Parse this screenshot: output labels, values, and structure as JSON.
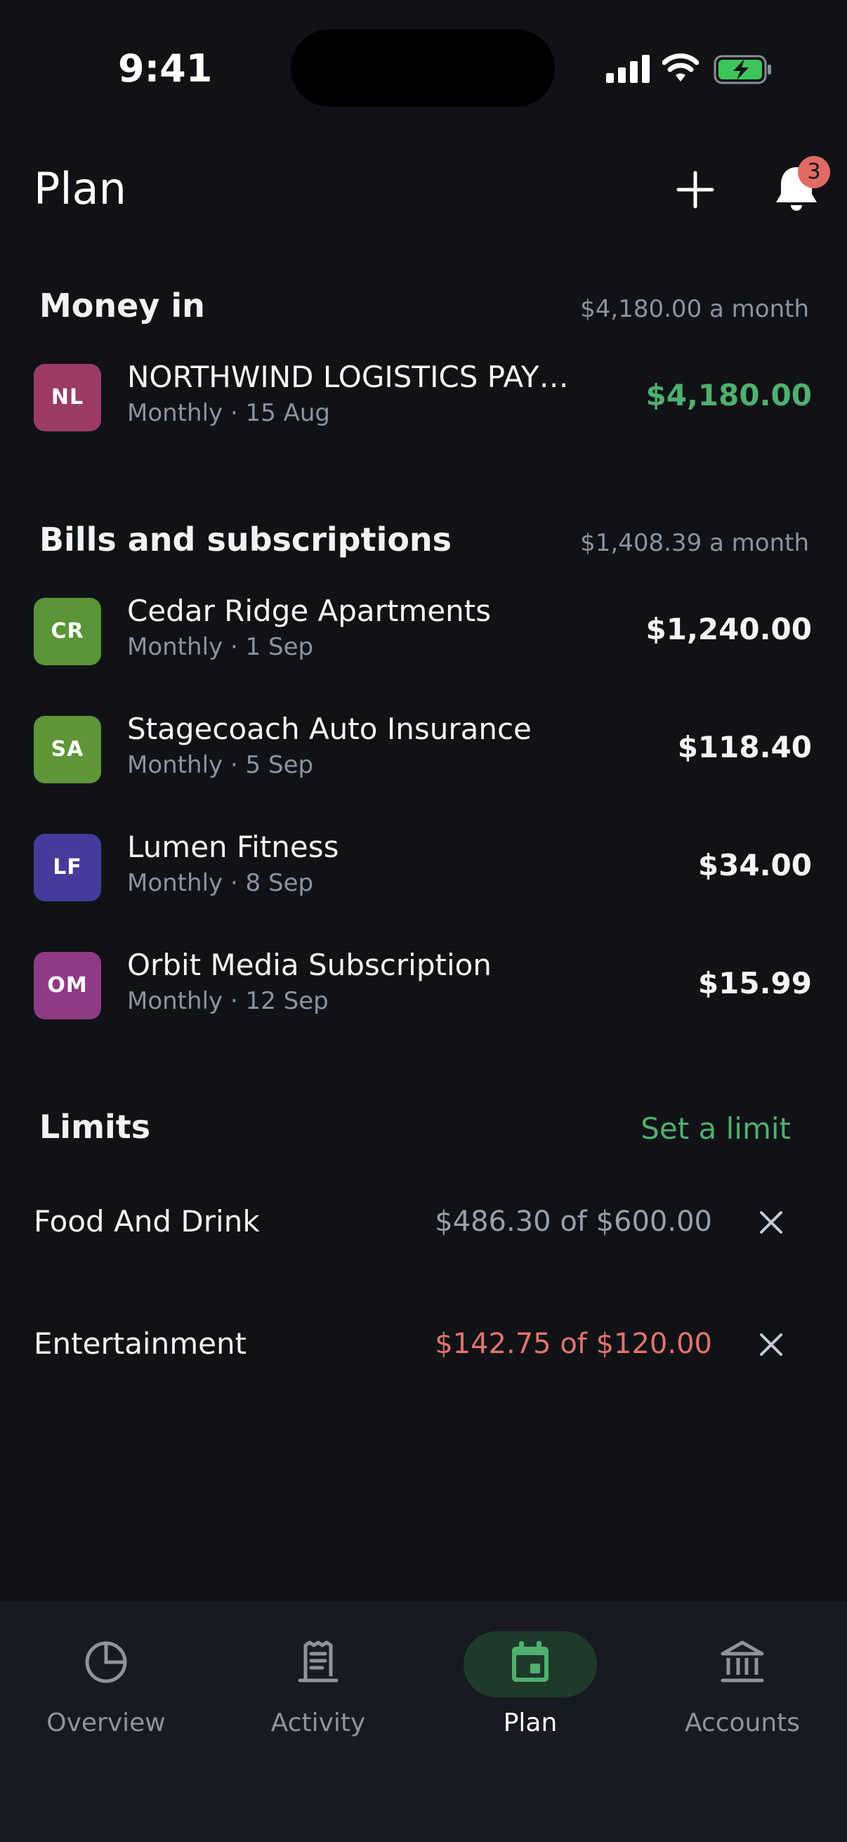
{
  "status_bar": {
    "time": "9:41"
  },
  "header": {
    "title": "Plan",
    "notification_count": "3",
    "add_icon": "plus-icon",
    "notif_icon": "bell-icon"
  },
  "money_in": {
    "title": "Money in",
    "summary": "$4,180.00 a month",
    "items": [
      {
        "initials": "NL",
        "name": "NORTHWIND LOGISTICS PAY…",
        "sub": "Monthly · 15 Aug",
        "amount": "$4,180.00",
        "color": "#9B3B66",
        "amount_color": "#4FB06E"
      }
    ]
  },
  "bills": {
    "title": "Bills and subscriptions",
    "summary": "$1,408.39 a month",
    "items": [
      {
        "initials": "CR",
        "name": "Cedar Ridge Apartments",
        "sub": "Monthly · 1 Sep",
        "amount": "$1,240.00",
        "color": "#5A9437"
      },
      {
        "initials": "SA",
        "name": "Stagecoach Auto Insurance",
        "sub": "Monthly · 5 Sep",
        "amount": "$118.40",
        "color": "#5E9638"
      },
      {
        "initials": "LF",
        "name": "Lumen Fitness",
        "sub": "Monthly · 8 Sep",
        "amount": "$34.00",
        "color": "#463B9A"
      },
      {
        "initials": "OM",
        "name": "Orbit Media Subscription",
        "sub": "Monthly · 12 Sep",
        "amount": "$15.99",
        "color": "#8F3A86"
      }
    ]
  },
  "limits": {
    "title": "Limits",
    "action": "Set a limit",
    "items": [
      {
        "name": "Food And Drink",
        "value": "$486.30 of $600.00",
        "color": "#9AA0A8"
      },
      {
        "name": "Entertainment",
        "value": "$142.75 of $120.00",
        "color": "#E0746C"
      }
    ]
  },
  "tabs": [
    {
      "label": "Overview",
      "icon": "pie-chart-icon"
    },
    {
      "label": "Activity",
      "icon": "receipt-icon"
    },
    {
      "label": "Plan",
      "icon": "calendar-icon",
      "active": true
    },
    {
      "label": "Accounts",
      "icon": "bank-icon"
    }
  ],
  "colors": {
    "accent": "#4FB06E",
    "background": "#101217",
    "tabbar": "#171A21",
    "over_limit": "#E0746C"
  }
}
